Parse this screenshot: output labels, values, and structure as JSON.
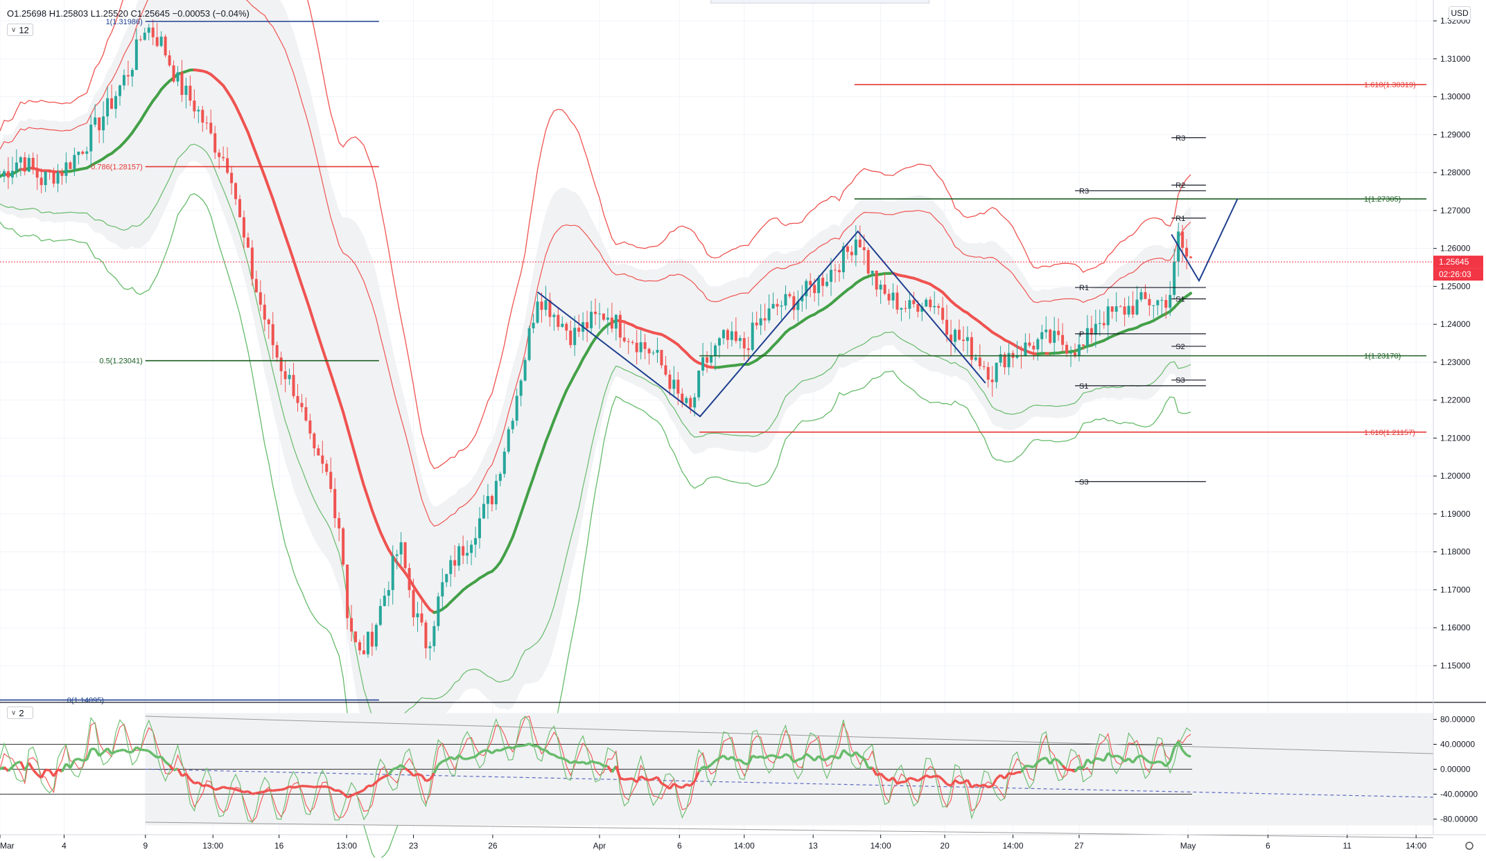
{
  "header": {
    "ohlc_text": "O1.25698  H1.25803  L1.25520  C1.25645  −0.00053  (−0.04%)",
    "interval_badge": "12",
    "osc_badge": "2",
    "currency": "USD"
  },
  "price_badge": {
    "value": "1.25645",
    "countdown": "02:26:03",
    "color": "#f23645"
  },
  "colors": {
    "up": "#26a69a",
    "down": "#ef5350",
    "wave": "#1e3f8f",
    "fib_green": "#1b5e20",
    "fib_red": "#e53935",
    "basis_up": "#43a047",
    "basis_down": "#ef5350"
  },
  "chart_data": [
    {
      "type": "candlestick",
      "title": "",
      "y_axis": {
        "min": 1.1405,
        "max": 1.3255,
        "ticks": [
          "1.32000",
          "1.31000",
          "1.30000",
          "1.29000",
          "1.28000",
          "1.27000",
          "1.26000",
          "1.25000",
          "1.24000",
          "1.23000",
          "1.22000",
          "1.21000",
          "1.20000",
          "1.19000",
          "1.18000",
          "1.17000",
          "1.16000",
          "1.15000"
        ],
        "tick_values": [
          1.32,
          1.31,
          1.3,
          1.29,
          1.28,
          1.27,
          1.26,
          1.25,
          1.24,
          1.23,
          1.22,
          1.21,
          1.2,
          1.19,
          1.18,
          1.17,
          1.16,
          1.15
        ]
      },
      "x_axis": {
        "labels": [
          "Mar",
          "4",
          "9",
          "13:00",
          "16",
          "13:00",
          "23",
          "26",
          "Apr",
          "6",
          "14:00",
          "13",
          "14:00",
          "20",
          "14:00",
          "27",
          "May",
          "6",
          "11",
          "14:00"
        ],
        "label_bars": [
          0,
          93,
          211,
          309,
          405,
          503,
          600,
          715,
          870,
          986,
          1080,
          1180,
          1278,
          1371,
          1470,
          1566,
          1724,
          1840,
          1955,
          2055
        ]
      },
      "bars_total": 2080,
      "price_path": [
        [
          0,
          1.279
        ],
        [
          30,
          1.284
        ],
        [
          60,
          1.278
        ],
        [
          93,
          1.281
        ],
        [
          125,
          1.288
        ],
        [
          160,
          1.298
        ],
        [
          190,
          1.308
        ],
        [
          211,
          1.319
        ],
        [
          235,
          1.314
        ],
        [
          260,
          1.303
        ],
        [
          285,
          1.297
        ],
        [
          310,
          1.288
        ],
        [
          335,
          1.281
        ],
        [
          350,
          1.265
        ],
        [
          370,
          1.25
        ],
        [
          390,
          1.238
        ],
        [
          405,
          1.23
        ],
        [
          430,
          1.222
        ],
        [
          455,
          1.205
        ],
        [
          475,
          1.2
        ],
        [
          495,
          1.185
        ],
        [
          503,
          1.165
        ],
        [
          520,
          1.152
        ],
        [
          540,
          1.158
        ],
        [
          560,
          1.17
        ],
        [
          580,
          1.182
        ],
        [
          600,
          1.165
        ],
        [
          620,
          1.155
        ],
        [
          640,
          1.17
        ],
        [
          660,
          1.178
        ],
        [
          680,
          1.183
        ],
        [
          700,
          1.19
        ],
        [
          715,
          1.195
        ],
        [
          735,
          1.21
        ],
        [
          760,
          1.23
        ],
        [
          780,
          1.248
        ],
        [
          800,
          1.244
        ],
        [
          830,
          1.237
        ],
        [
          860,
          1.241
        ],
        [
          880,
          1.243
        ],
        [
          900,
          1.239
        ],
        [
          920,
          1.236
        ],
        [
          950,
          1.232
        ],
        [
          970,
          1.226
        ],
        [
          986,
          1.22
        ],
        [
          1002,
          1.217
        ],
        [
          1020,
          1.229
        ],
        [
          1050,
          1.236
        ],
        [
          1080,
          1.234
        ],
        [
          1100,
          1.24
        ],
        [
          1130,
          1.245
        ],
        [
          1160,
          1.247
        ],
        [
          1180,
          1.25
        ],
        [
          1200,
          1.253
        ],
        [
          1230,
          1.259
        ],
        [
          1245,
          1.264
        ],
        [
          1260,
          1.255
        ],
        [
          1278,
          1.248
        ],
        [
          1300,
          1.246
        ],
        [
          1320,
          1.244
        ],
        [
          1340,
          1.247
        ],
        [
          1360,
          1.245
        ],
        [
          1380,
          1.238
        ],
        [
          1400,
          1.235
        ],
        [
          1420,
          1.231
        ],
        [
          1440,
          1.227
        ],
        [
          1460,
          1.232
        ],
        [
          1480,
          1.233
        ],
        [
          1500,
          1.235
        ],
        [
          1520,
          1.236
        ],
        [
          1545,
          1.235
        ],
        [
          1570,
          1.233
        ],
        [
          1590,
          1.241
        ],
        [
          1620,
          1.243
        ],
        [
          1660,
          1.246
        ],
        [
          1690,
          1.246
        ],
        [
          1700,
          1.249
        ],
        [
          1710,
          1.263
        ],
        [
          1720,
          1.258
        ],
        [
          1730,
          1.2565
        ]
      ],
      "fib_levels": [
        {
          "label": "1(1.31986)",
          "price": 1.31986,
          "color": "#1e3f8f",
          "x_from": 211,
          "x_to": 550
        },
        {
          "label": "0.786(1.28157)",
          "price": 1.28157,
          "color": "#e53935",
          "x_from": 211,
          "x_to": 550
        },
        {
          "label": "0.5(1.23041)",
          "price": 1.23041,
          "color": "#1b5e20",
          "x_from": 211,
          "x_to": 550
        },
        {
          "label": "0(1.14095)",
          "price": 1.14095,
          "color": "#1e3f8f",
          "x_from": 0,
          "x_to": 550
        },
        {
          "label": "1.618(1.30319)",
          "price": 1.30319,
          "color": "#e53935",
          "x_from": 1240,
          "x_to": 2070
        },
        {
          "label": "1(1.27305)",
          "price": 1.27305,
          "color": "#1b5e20",
          "x_from": 1240,
          "x_to": 2070
        },
        {
          "label": "1(1.23170)",
          "price": 1.2317,
          "color": "#1b5e20",
          "x_from": 1015,
          "x_to": 2070
        },
        {
          "label": "1.618(1.21157)",
          "price": 1.21157,
          "color": "#e53935",
          "x_from": 1015,
          "x_to": 2070
        }
      ],
      "pivots": [
        {
          "label": "R3",
          "price": 1.2892,
          "x_from": 1700,
          "x_to": 1750
        },
        {
          "label": "R2",
          "price": 1.2767,
          "x_from": 1700,
          "x_to": 1750
        },
        {
          "label": "R3",
          "price": 1.2752,
          "x_from": 1560,
          "x_to": 1750
        },
        {
          "label": "R1",
          "price": 1.268,
          "x_from": 1700,
          "x_to": 1750
        },
        {
          "label": "R1",
          "price": 1.2497,
          "x_from": 1560,
          "x_to": 1750
        },
        {
          "label": "S1",
          "price": 1.2467,
          "x_from": 1700,
          "x_to": 1750
        },
        {
          "label": "P",
          "price": 1.2375,
          "x_from": 1560,
          "x_to": 1750
        },
        {
          "label": "S2",
          "price": 1.2342,
          "x_from": 1700,
          "x_to": 1750
        },
        {
          "label": "S3",
          "price": 1.2253,
          "x_from": 1700,
          "x_to": 1750
        },
        {
          "label": "S1",
          "price": 1.2238,
          "x_from": 1560,
          "x_to": 1750
        },
        {
          "label": "S3",
          "price": 1.1985,
          "x_from": 1560,
          "x_to": 1750
        }
      ],
      "wave_lines": [
        [
          [
            780,
            1.2485
          ],
          [
            1016,
            1.2157
          ],
          [
            1245,
            1.2645
          ],
          [
            1430,
            1.2245
          ]
        ],
        [
          [
            1700,
            1.2637
          ],
          [
            1740,
            1.2515
          ],
          [
            1796,
            1.2731
          ]
        ]
      ]
    },
    {
      "type": "line",
      "title": "",
      "y_axis": {
        "min": -105,
        "max": 105,
        "ticks": [
          "80.00000",
          "40.00000",
          "0.00000",
          "-40.00000",
          "-80.00000"
        ],
        "tick_values": [
          80,
          40,
          0,
          -40,
          -80
        ]
      },
      "levels": [
        40,
        0,
        -40
      ],
      "series": [
        {
          "values": []
        }
      ]
    }
  ]
}
